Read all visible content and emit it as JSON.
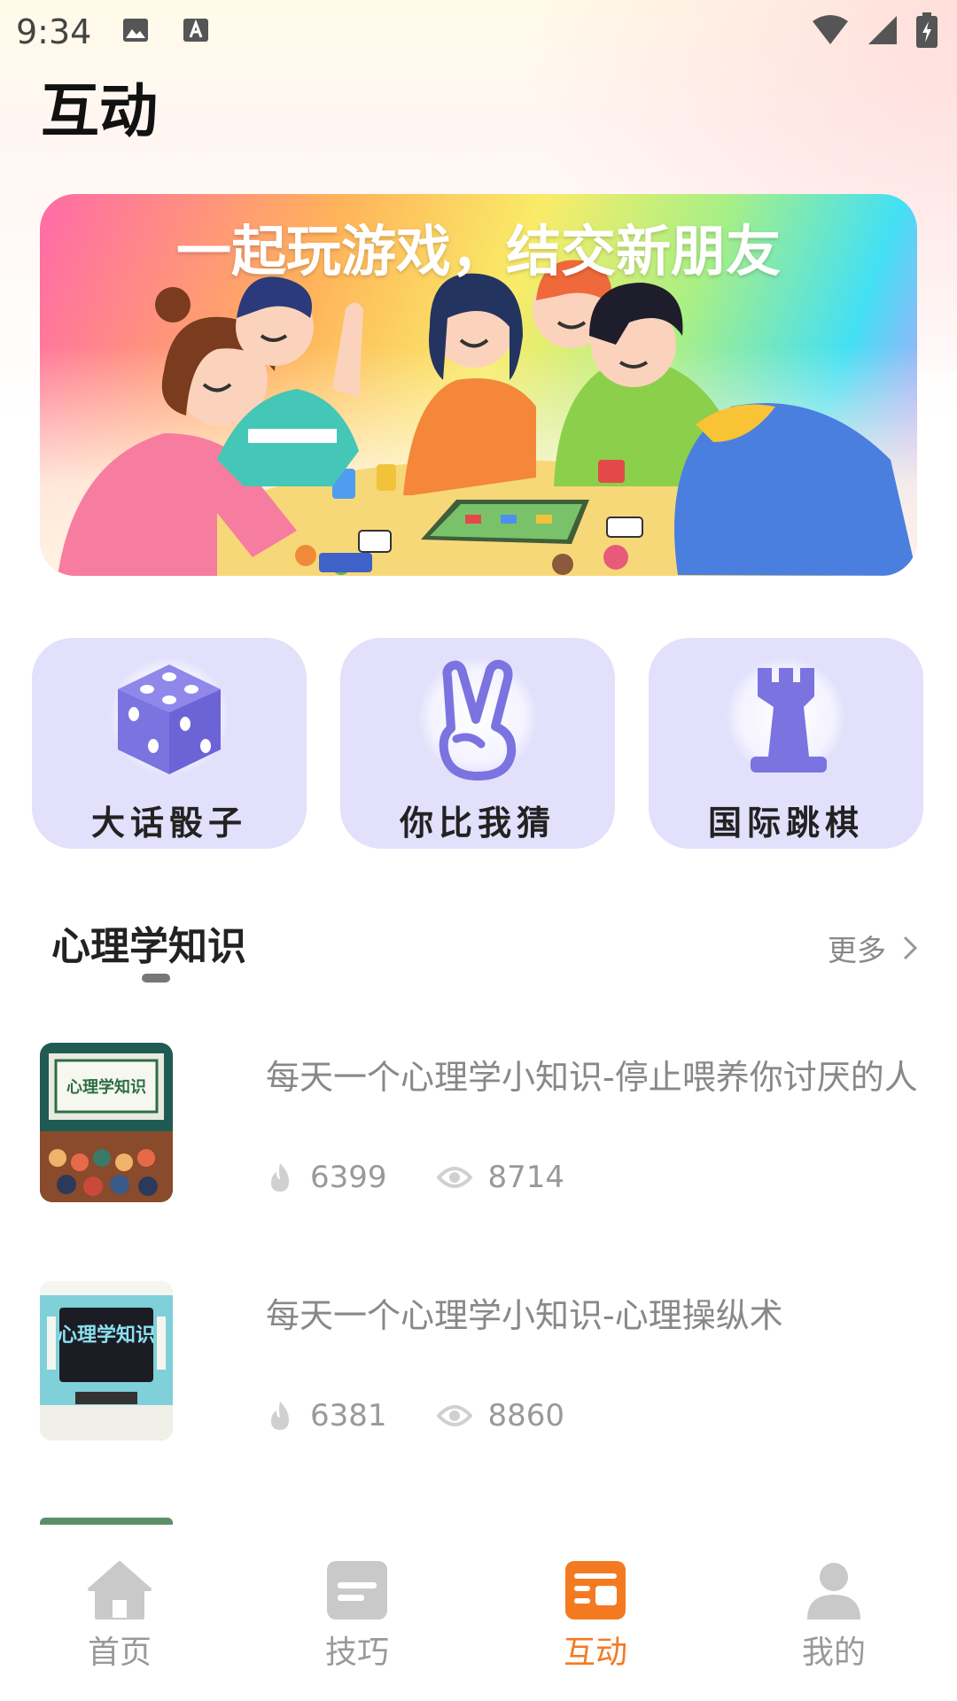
{
  "status_bar": {
    "time": "9:34"
  },
  "page": {
    "title": "互动"
  },
  "banner": {
    "headline": "一起玩游戏，结交新朋友"
  },
  "games": [
    {
      "label": "大话骰子",
      "icon": "dice-icon"
    },
    {
      "label": "你比我猜",
      "icon": "victory-hand-icon"
    },
    {
      "label": "国际跳棋",
      "icon": "chess-rook-icon"
    }
  ],
  "section": {
    "title": "心理学知识",
    "more_label": "更多"
  },
  "articles": [
    {
      "title": "每天一个心理学小知识-停止喂养你讨厌的人",
      "likes": "6399",
      "views": "8714",
      "thumb_text": "心理学知识"
    },
    {
      "title": "每天一个心理学小知识-心理操纵术",
      "likes": "6381",
      "views": "8860",
      "thumb_text": "心理学知识"
    }
  ],
  "nav": [
    {
      "label": "首页",
      "icon": "home-icon",
      "active": false
    },
    {
      "label": "技巧",
      "icon": "tips-icon",
      "active": false
    },
    {
      "label": "互动",
      "icon": "interaction-icon",
      "active": true
    },
    {
      "label": "我的",
      "icon": "profile-icon",
      "active": false
    }
  ],
  "colors": {
    "accent": "#f47a22",
    "card_bg": "#e2e0fb",
    "icon_purple": "#7b73e0"
  }
}
